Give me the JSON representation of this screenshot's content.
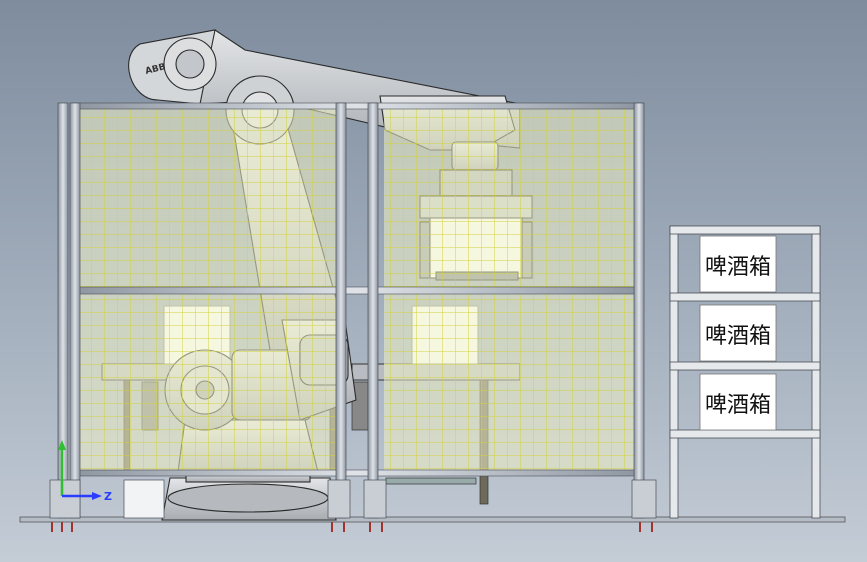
{
  "scene": {
    "robot_brand": "ABB",
    "shelf_labels": [
      "啤酒箱",
      "啤酒箱",
      "啤酒箱"
    ],
    "axis_label": "Z"
  },
  "colors": {
    "background_top": "#7e8c9e",
    "mesh_fill": "#eef0c4",
    "mesh_line": "#d8d84a",
    "frame": "#aab1bb",
    "robot_body": "#c9cccf",
    "axis_y": "#2ec02e",
    "axis_z": "#2a3cff"
  }
}
